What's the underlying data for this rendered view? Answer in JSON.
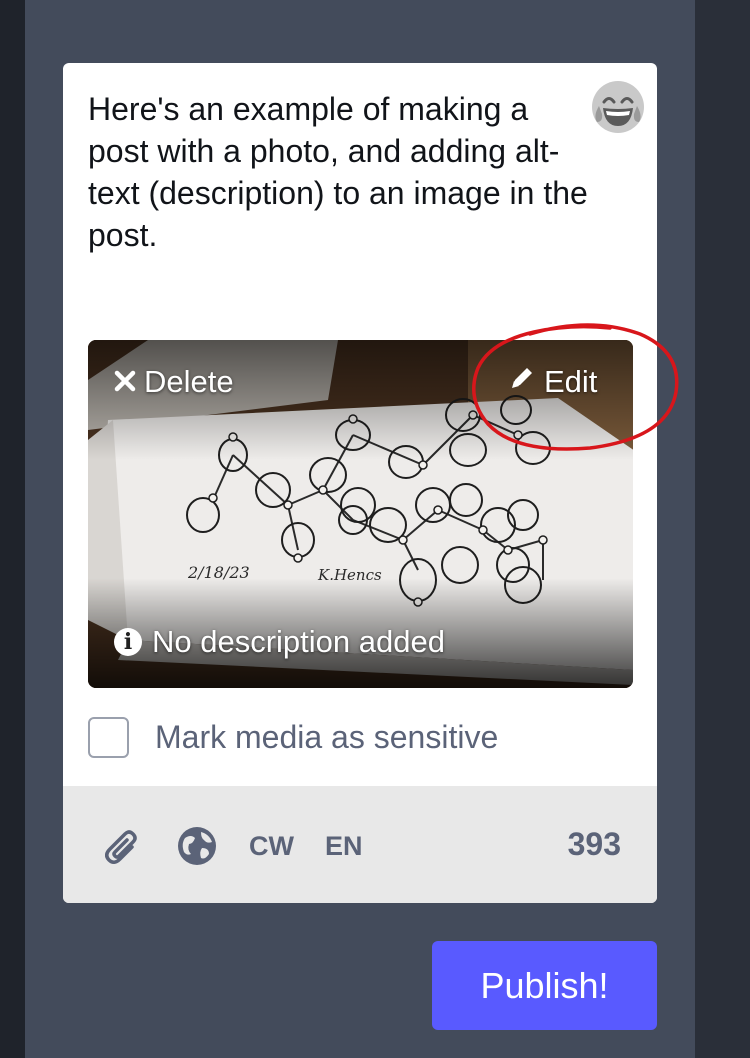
{
  "compose": {
    "text": "Here's an example of making a post with a photo, and adding alt-text (description) to an image in the post.",
    "emoji_icon": "laughing-tears-emoji-icon",
    "media": {
      "delete_label": "Delete",
      "edit_label": "Edit",
      "alt_status": "No description added",
      "photo_handwriting_date": "2/18/23",
      "photo_handwriting_signature": "K.Hencs"
    },
    "sensitive_label": "Mark media as sensitive",
    "sensitive_checked": false
  },
  "toolbar": {
    "attach_icon": "paperclip-icon",
    "visibility_icon": "globe-icon",
    "cw_label": "CW",
    "language_label": "EN",
    "char_count": "393"
  },
  "publish_label": "Publish!",
  "colors": {
    "accent": "#595aff",
    "annotation": "#d8161b",
    "column_bg": "#434b5b",
    "muted_text": "#5b6378"
  }
}
